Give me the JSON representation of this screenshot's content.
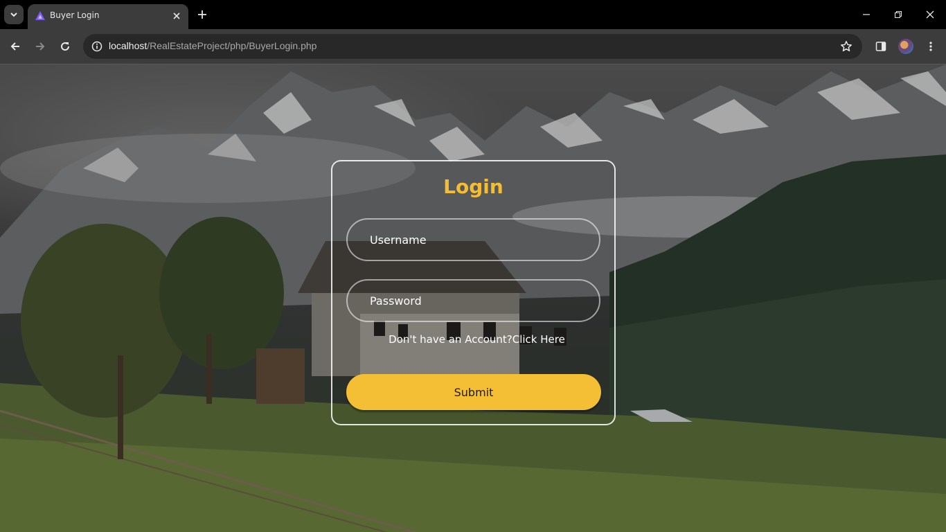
{
  "browser": {
    "tab": {
      "title": "Buyer Login"
    },
    "address": {
      "host": "localhost",
      "path": "/RealEstateProject/php/BuyerLogin.php"
    },
    "colors": {
      "tabbar": "#000000",
      "toolbar": "#3c3c3c",
      "omnibox": "#282828"
    }
  },
  "login": {
    "title": "Login",
    "username_placeholder": "Username",
    "password_placeholder": "Password",
    "signup_prompt": "Don't have an Account?",
    "signup_link": "Click Here",
    "submit_label": "Submit",
    "colors": {
      "accent": "#f4bd33",
      "button": "#f4bf35"
    }
  },
  "icons": {
    "tab_menu": "chevron-down-icon",
    "favicon": "triangle-logo-icon",
    "tab_close": "close-icon",
    "new_tab": "plus-icon",
    "minimize": "minimize-icon",
    "restore": "restore-icon",
    "close_window": "close-icon",
    "back": "arrow-left-icon",
    "forward": "arrow-right-icon",
    "reload": "reload-icon",
    "site_info": "info-icon",
    "bookmark": "star-icon",
    "side_panel": "side-panel-icon",
    "profile": "avatar",
    "menu": "kebab-menu-icon"
  }
}
